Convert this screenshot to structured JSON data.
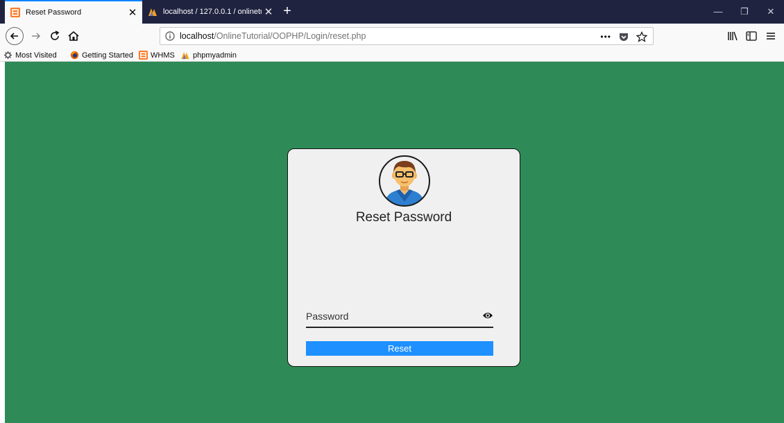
{
  "tabs": [
    {
      "title": "Reset Password",
      "active": true,
      "icon": "xampp-icon"
    },
    {
      "title": "localhost / 127.0.0.1 / onlinetut",
      "active": false,
      "icon": "phpmyadmin-icon"
    }
  ],
  "navbar": {
    "url_host": "localhost",
    "url_path": "/OnlineTutorial/OOPHP/Login/reset.php"
  },
  "bookmarks": [
    {
      "label": "Most Visited",
      "icon": "gear-icon"
    },
    {
      "label": "Getting Started",
      "icon": "firefox-icon"
    },
    {
      "label": "WHMS",
      "icon": "xampp-icon"
    },
    {
      "label": "phpmyadmin",
      "icon": "phpmyadmin-icon"
    }
  ],
  "page": {
    "background": "#2e8b57",
    "card": {
      "title": "Reset Password",
      "password_placeholder": "Password",
      "reset_label": "Reset",
      "button_color": "#1e90ff"
    }
  }
}
